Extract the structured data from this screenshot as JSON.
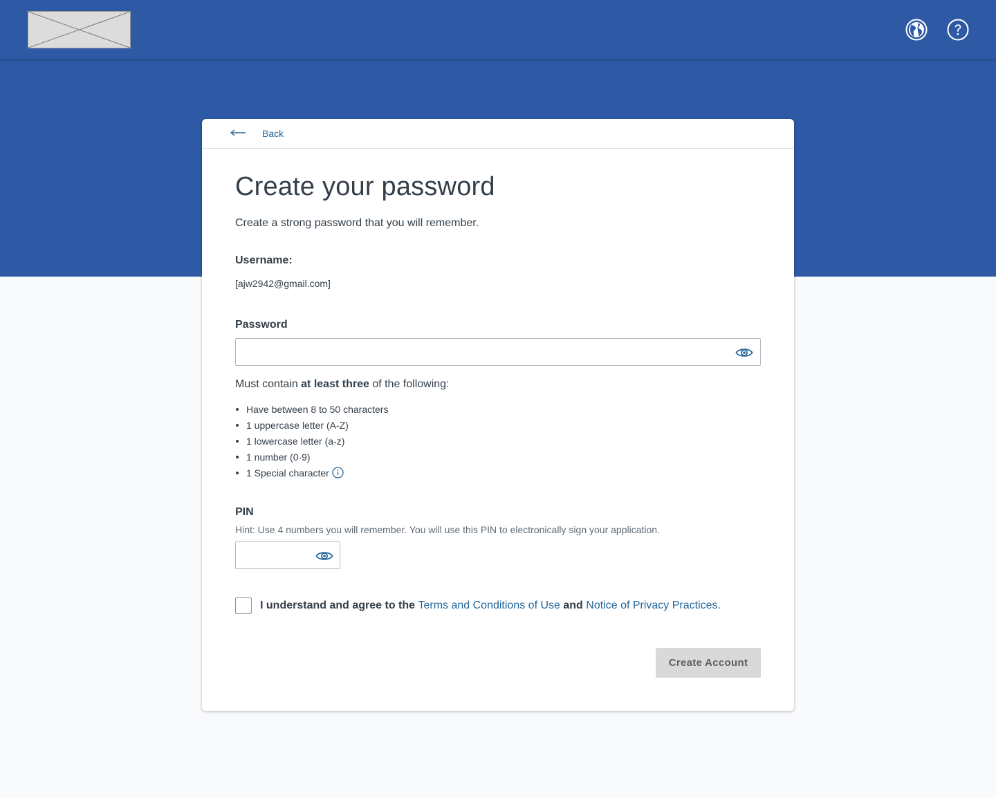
{
  "header": {
    "logo_alt": "",
    "globe_icon": "globe-icon",
    "help_icon": "help-icon"
  },
  "card": {
    "back_label": "Back",
    "title": "Create your password",
    "subtitle": "Create a strong password that you will remember.",
    "username": {
      "label": "Username:",
      "value": "[ajw2942@gmail.com]"
    },
    "password": {
      "label": "Password",
      "value": "",
      "placeholder": "",
      "requirements_prefix": "Must contain ",
      "requirements_emphasis": "at least three",
      "requirements_suffix": " of the following:",
      "rules": [
        "Have between 8 to 50 characters",
        "1 uppercase letter (A-Z)",
        "1 lowercase letter (a-z)",
        "1 number (0-9)",
        "1 Special character"
      ]
    },
    "pin": {
      "label": "PIN",
      "hint": "Hint: Use 4 numbers you will remember. You will use this PIN to electronically sign your application.",
      "value": ""
    },
    "agreement": {
      "prefix": "I understand and agree to the ",
      "terms_link": "Terms and Conditions of Use",
      "middle": " and ",
      "privacy_link": "Notice of Privacy Practices.",
      "checked": false
    },
    "create_button": "Create Account"
  },
  "colors": {
    "brand_blue": "#2d59a5",
    "link_blue": "#24669a",
    "text": "#333e48",
    "disabled_button": "#d9d9d9"
  }
}
